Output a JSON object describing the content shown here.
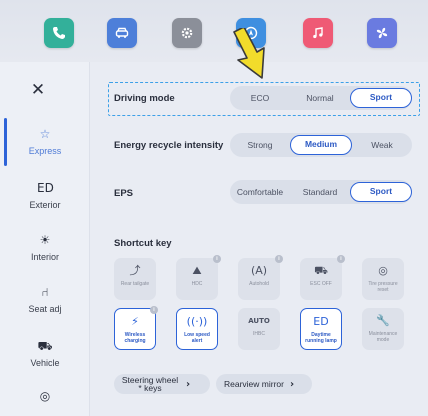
{
  "app_bar": {
    "apps": [
      {
        "icon": "phone-icon",
        "color": "#33b09a"
      },
      {
        "icon": "car-icon",
        "color": "#4d7fd9"
      },
      {
        "icon": "settings-gear-icon",
        "color": "#8b8f99"
      },
      {
        "icon": "navigation-icon",
        "color": "#3f8fe0"
      },
      {
        "icon": "music-icon",
        "color": "#ef5a75"
      },
      {
        "icon": "fan-icon",
        "color": "#6a7be0"
      }
    ]
  },
  "sidebar": {
    "close_icon": "close-icon",
    "items": [
      {
        "label": "Express",
        "icon": "star-icon",
        "glyph": "☆",
        "active": true
      },
      {
        "label": "Exterior",
        "icon": "headlight-icon",
        "glyph": "ED",
        "active": false
      },
      {
        "label": "Interior",
        "icon": "interior-light-icon",
        "glyph": "☀",
        "active": false
      },
      {
        "label": "Seat adj",
        "icon": "seat-icon",
        "glyph": "⑁",
        "active": false
      },
      {
        "label": "Vehicle",
        "icon": "vehicle-icon",
        "glyph": "⛟",
        "active": false
      },
      {
        "label": "",
        "icon": "steering-wheel-icon",
        "glyph": "◎",
        "active": false
      }
    ]
  },
  "driving_mode": {
    "label": "Driving mode",
    "options": [
      "ECO",
      "Normal",
      "Sport"
    ],
    "selected": "Sport"
  },
  "energy_recycle": {
    "label": "Energy recycle intensity",
    "options": [
      "Strong",
      "Medium",
      "Weak"
    ],
    "selected": "Medium"
  },
  "eps": {
    "label": "EPS",
    "options": [
      "Comfortable",
      "Standard",
      "Sport"
    ],
    "selected": "Sport"
  },
  "shortcut_key": {
    "label": "Shortcut key",
    "keys": [
      {
        "label": "Rear tailgate",
        "glyph": "⤴",
        "icon": "tailgate-icon",
        "on": false,
        "info": false
      },
      {
        "label": "HDC",
        "glyph": "⛰",
        "icon": "hill-descent-icon",
        "on": false,
        "info": true
      },
      {
        "label": "Autohold",
        "glyph": "(A)",
        "icon": "autohold-icon",
        "on": false,
        "info": true
      },
      {
        "label": "ESC OFF",
        "glyph": "⛟",
        "icon": "esc-off-icon",
        "on": false,
        "info": true
      },
      {
        "label": "Tire pressure reset",
        "glyph": "◎",
        "icon": "tire-pressure-icon",
        "on": false,
        "info": false
      },
      {
        "label": "Wireless charging",
        "glyph": "⚡",
        "icon": "wireless-charging-icon",
        "on": true,
        "info": true
      },
      {
        "label": "Low speed alert",
        "glyph": "((·))",
        "icon": "low-speed-alert-icon",
        "on": true,
        "info": false
      },
      {
        "label": "IHBC",
        "glyph": "AUTO",
        "icon": "ihbc-icon",
        "on": false,
        "info": false
      },
      {
        "label": "Daytime running lamp",
        "glyph": "ED",
        "icon": "daytime-lamp-icon",
        "on": true,
        "info": false
      },
      {
        "label": "Maintenance mode",
        "glyph": "🔧",
        "icon": "wrench-icon",
        "on": false,
        "info": false
      }
    ]
  },
  "links": {
    "steering_wheel_keys": "Steering wheel * keys",
    "rearview_mirror": "Rearview mirror"
  },
  "colors": {
    "accent": "#2d63d8",
    "highlight_arrow": "#f2dc2b",
    "dashed_box": "#3ca0e8"
  }
}
